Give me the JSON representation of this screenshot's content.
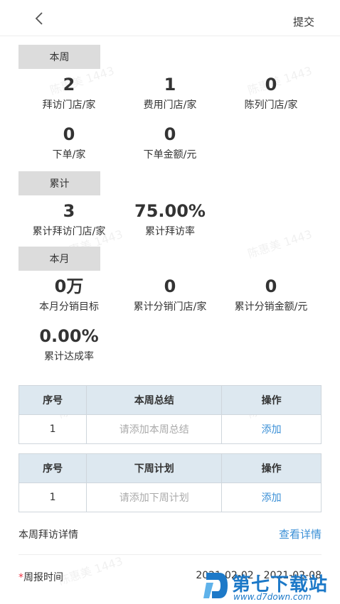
{
  "header": {
    "submit_label": "提交"
  },
  "week": {
    "tag": "本周",
    "stats": [
      {
        "value": "2",
        "label": "拜访门店/家"
      },
      {
        "value": "1",
        "label": "费用门店/家"
      },
      {
        "value": "0",
        "label": "陈列门店/家"
      },
      {
        "value": "0",
        "label": "下单/家"
      },
      {
        "value": "0",
        "label": "下单金额/元"
      }
    ]
  },
  "cumulative": {
    "tag": "累计",
    "stats": [
      {
        "value": "3",
        "label": "累计拜访门店/家"
      },
      {
        "value": "75.00%",
        "label": "累计拜访率"
      }
    ]
  },
  "month": {
    "tag": "本月",
    "stats": [
      {
        "value": "0万",
        "label": "本月分销目标"
      },
      {
        "value": "0",
        "label": "累计分销门店/家"
      },
      {
        "value": "0",
        "label": "累计分销金额/元"
      },
      {
        "value": "0.00%",
        "label": "累计达成率"
      }
    ]
  },
  "summary_table": {
    "headers": [
      "序号",
      "本周总结",
      "操作"
    ],
    "rows": [
      {
        "index": "1",
        "content": "请添加本周总结",
        "action": "添加"
      }
    ]
  },
  "plan_table": {
    "headers": [
      "序号",
      "下周计划",
      "操作"
    ],
    "rows": [
      {
        "index": "1",
        "content": "请添加下周计划",
        "action": "添加"
      }
    ]
  },
  "visit_details": {
    "label": "本周拜访详情",
    "link": "查看详情"
  },
  "report_time": {
    "required_mark": "*",
    "label": "周报时间",
    "value": "2021-02-02 - 2021-02-08"
  },
  "watermark": "陈惠美 1443",
  "site_badge": {
    "title": "第七下载站",
    "url": "www.d7down.com"
  },
  "colors": {
    "accent": "#3a8fd6",
    "tag_bg": "#dcdcdc",
    "table_header_bg": "#dde8f0"
  }
}
